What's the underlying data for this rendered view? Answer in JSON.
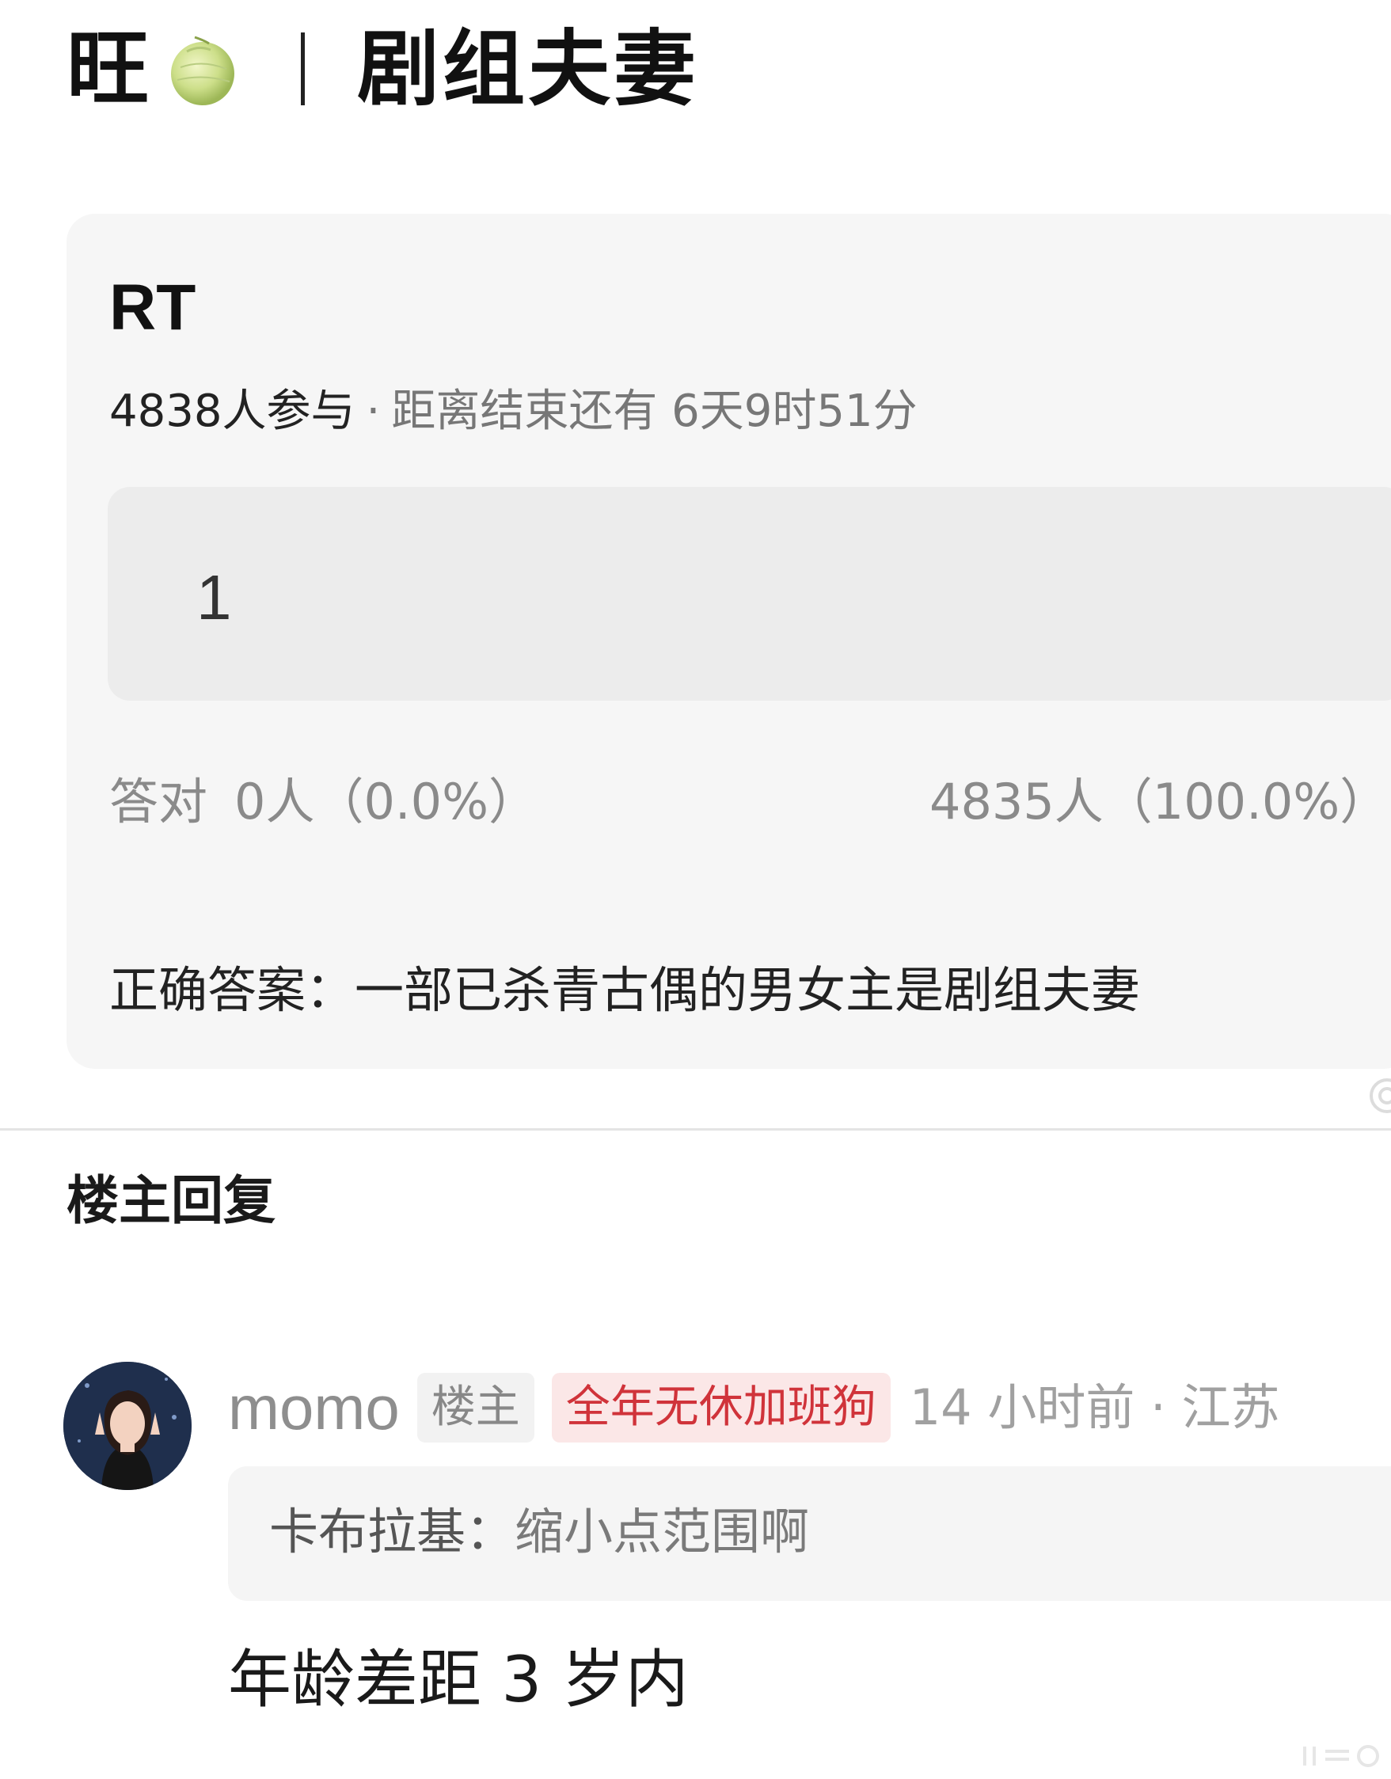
{
  "header": {
    "prefix": "旺",
    "emoji_icon": "melon-icon",
    "title": "剧组夫妻"
  },
  "quiz": {
    "title": "RT",
    "participants": "4838人参与",
    "separator": "·",
    "time_remaining": "距离结束还有 6天9时51分",
    "option_label": "1",
    "correct_label": "答对",
    "correct_count": "0人（0.0%）",
    "wrong_count": "4835人（100.0%）",
    "answer": "正确答案：一部已杀青古偶的男女主是剧组夫妻"
  },
  "section": {
    "heading": "楼主回复"
  },
  "reply": {
    "username": "momo",
    "op_badge": "楼主",
    "title_badge": "全年无休加班狗",
    "time_location": "14 小时前 · 江苏",
    "quote_author": "卡布拉基：",
    "quote_text": "缩小点范围啊",
    "body": "年龄差距 3 岁内"
  },
  "colors": {
    "card_bg": "#f6f6f6",
    "option_bg": "#ececec",
    "badge_red": "#d0333a",
    "badge_red_bg": "#fbe7e7",
    "muted_text": "#8a8a8a"
  }
}
